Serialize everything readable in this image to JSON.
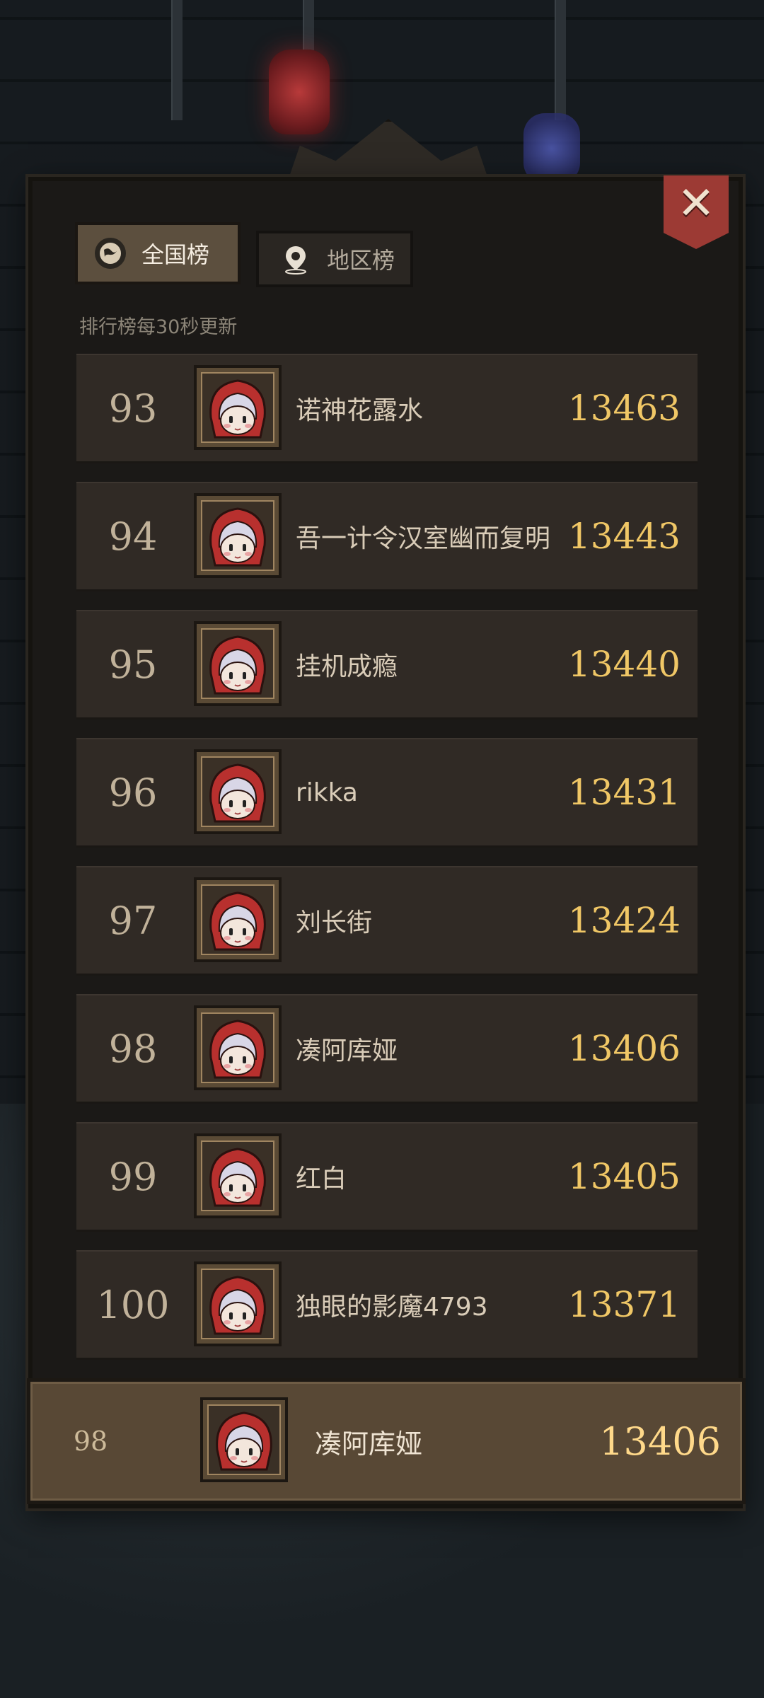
{
  "tabs": {
    "national": {
      "label": "全国榜",
      "icon": "globe-icon"
    },
    "region": {
      "label": "地区榜",
      "icon": "location-pin-icon"
    }
  },
  "update_note": "排行榜每30秒更新",
  "close_icon": "close-icon",
  "rows": [
    {
      "rank": "93",
      "name": "诺神花露水",
      "score": "13463"
    },
    {
      "rank": "94",
      "name": "吾一计令汉室幽而复明",
      "score": "13443"
    },
    {
      "rank": "95",
      "name": "挂机成瘾",
      "score": "13440"
    },
    {
      "rank": "96",
      "name": "rikka",
      "score": "13431"
    },
    {
      "rank": "97",
      "name": "刘长街",
      "score": "13424"
    },
    {
      "rank": "98",
      "name": "凑阿库娅",
      "score": "13406"
    },
    {
      "rank": "99",
      "name": "红白",
      "score": "13405"
    },
    {
      "rank": "100",
      "name": "独眼的影魔4793",
      "score": "13371"
    }
  ],
  "self": {
    "rank": "98",
    "name": "凑阿库娅",
    "score": "13406"
  },
  "colors": {
    "score": "#f0c766",
    "row_bg": "#302a25",
    "close_button": "#9c3a34",
    "active_tab": "#5c4f3e"
  }
}
